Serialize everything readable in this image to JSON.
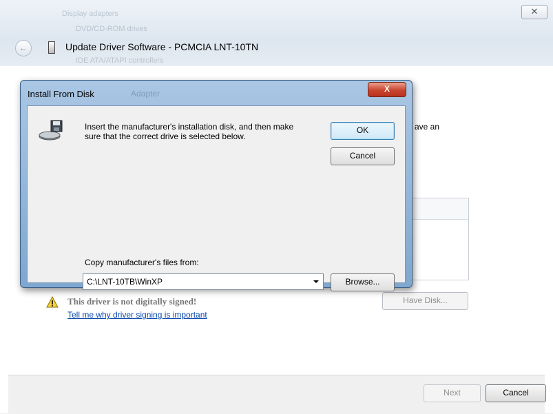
{
  "outer_window": {
    "title": "Update Driver Software - PCMCIA LNT-10TN",
    "close_label": "✕",
    "back_arrow": "←",
    "background_items": [
      "Display adapters",
      "DVD/CD-ROM drives",
      "IDE ATA/ATAPI controllers"
    ],
    "partial_text": "ave an",
    "warning_text": "This driver is not digitally signed!",
    "warning_link": "Tell me why driver signing is important",
    "have_disk_label": "Have Disk...",
    "next_label": "Next",
    "cancel_label": "Cancel",
    "icons": {
      "back": "back-arrow-icon",
      "device": "device-icon",
      "warning": "warning-icon"
    }
  },
  "dialog": {
    "title": "Install From Disk",
    "ghost_title": "Adapter",
    "close_label": "X",
    "message": "Insert the manufacturer's installation disk, and then make sure that the correct drive is selected below.",
    "ok_label": "OK",
    "cancel_label": "Cancel",
    "copy_label": "Copy manufacturer's files from:",
    "copy_value": "C:\\LNT-10TB\\WinXP",
    "browse_label": "Browse...",
    "icons": {
      "disk": "install-disk-icon",
      "dropdown": "chevron-down-icon"
    }
  },
  "colors": {
    "dialog_frame": "#aac7e4",
    "close_button": "#c8452f",
    "link": "#0645ad",
    "ok_button": "#cfe8f8"
  }
}
